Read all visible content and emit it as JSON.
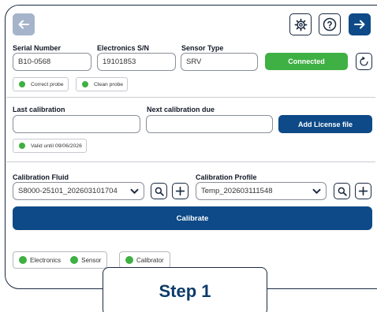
{
  "toolbar": {
    "back_icon": "arrow-left-icon",
    "settings_icon": "gear-icon",
    "help_icon": "question-circle-icon",
    "next_icon": "arrow-right-icon"
  },
  "sensor": {
    "serial_label": "Serial Number",
    "serial_value": "B10-0568",
    "electronics_label": "Electronics S/N",
    "electronics_value": "19101853",
    "type_label": "Sensor Type",
    "type_value": "SRV",
    "connection_status": "Connected",
    "refresh_icon": "refresh-icon"
  },
  "probe_checks": [
    {
      "label": "Correct probe",
      "status": "green"
    },
    {
      "label": "Clean probe",
      "status": "green"
    }
  ],
  "calibration_dates": {
    "last_label": "Last calibration",
    "last_value": "",
    "next_label": "Next calibration due",
    "next_value": "",
    "add_license_label": "Add License file",
    "validity_text": "Valid until 09/06/2026"
  },
  "fluid": {
    "label": "Calibration Fluid",
    "selected": "S8000-25101_202603101704"
  },
  "profile": {
    "label": "Calibration Profile",
    "selected": "Temp_202603111548"
  },
  "calibrate_label": "Calibrate",
  "status_indicators": {
    "electronics": "Electronics",
    "sensor": "Sensor",
    "calibrator": "Calibrator"
  },
  "step_label": "Step 1",
  "colors": {
    "primary": "#0d4a87",
    "success": "#3fb043",
    "back_button": "#a5b4cb",
    "frame": "#1a2a40"
  }
}
